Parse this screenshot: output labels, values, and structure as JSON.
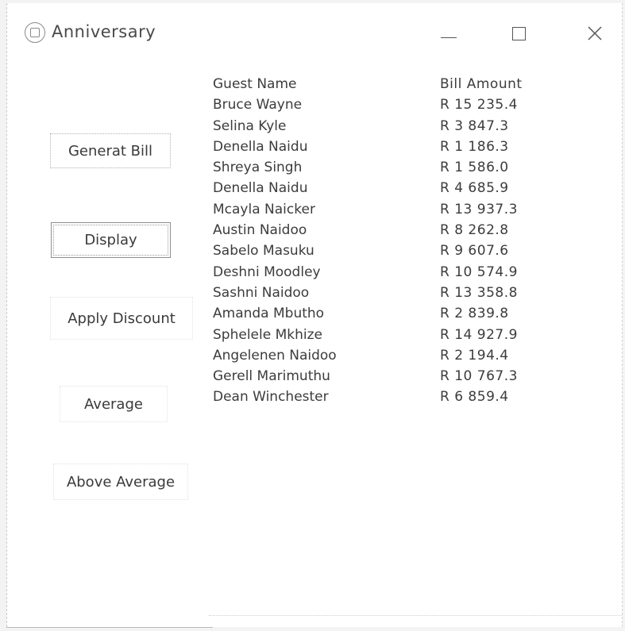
{
  "window": {
    "title": "Anniversary",
    "app_icon": "app-emblem-icon",
    "controls": {
      "minimize": "minimize-icon",
      "maximize": "maximize-icon",
      "close": "close-icon"
    }
  },
  "buttons": {
    "generate_bill": "Generat Bill",
    "display": "Display",
    "apply_discount": "Apply Discount",
    "average": "Average",
    "above_average": "Above Average"
  },
  "table": {
    "headers": {
      "name": "Guest Name",
      "amount": "Bill Amount"
    },
    "rows": [
      {
        "name": "Bruce Wayne",
        "amount": "R 15 235.4"
      },
      {
        "name": "Selina Kyle",
        "amount": "R 3 847.3"
      },
      {
        "name": "Denella Naidu",
        "amount": "R 1 186.3"
      },
      {
        "name": "Shreya Singh",
        "amount": "R 1 586.0"
      },
      {
        "name": "Denella Naidu",
        "amount": "R 4 685.9"
      },
      {
        "name": "Mcayla Naicker",
        "amount": "R 13 937.3"
      },
      {
        "name": "Austin Naidoo",
        "amount": "R 8 262.8"
      },
      {
        "name": "Sabelo Masuku",
        "amount": "R 9 607.6"
      },
      {
        "name": "Deshni Moodley",
        "amount": "R 10 574.9"
      },
      {
        "name": "Sashni Naidoo",
        "amount": "R 13 358.8"
      },
      {
        "name": "Amanda Mbutho",
        "amount": "R 2 839.8"
      },
      {
        "name": "Sphelele Mkhize",
        "amount": "R 14 927.9"
      },
      {
        "name": "Angelenen Naidoo",
        "amount": "R 2 194.4"
      },
      {
        "name": "Gerell Marimuthu",
        "amount": "R 10 767.3"
      },
      {
        "name": "Dean Winchester",
        "amount": "R 6 859.4"
      }
    ]
  }
}
